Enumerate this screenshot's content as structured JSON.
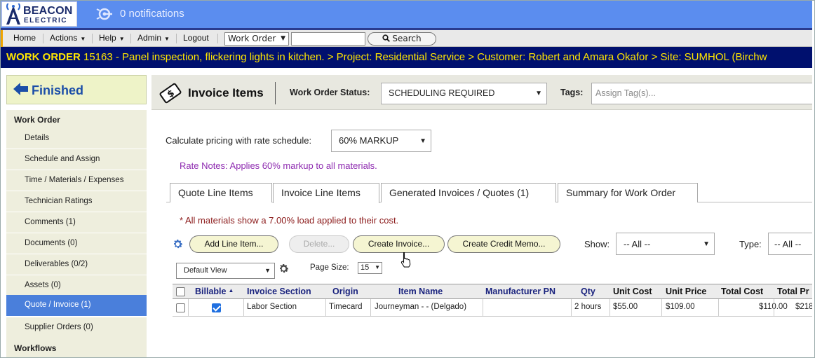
{
  "brand": {
    "line1": "BEACON",
    "line2": "ELECTRIC"
  },
  "notifications": {
    "text": "0 notifications"
  },
  "menu": {
    "home": "Home",
    "actions": "Actions",
    "help": "Help",
    "admin": "Admin",
    "logout": "Logout",
    "search_scope": "Work Order",
    "search_value": "",
    "search_button": "Search"
  },
  "breadcrumb": {
    "prefix": "WORK ORDER",
    "text": " 15163 - Panel inspection, flickering lights in kitchen. > Project: Residential Service > Customer: Robert and Amara Okafor > Site: SUMHOL (Birchw"
  },
  "sidebar": {
    "finished": "Finished",
    "section_work_order": "Work Order",
    "items": [
      {
        "label": "Details"
      },
      {
        "label": "Schedule and Assign"
      },
      {
        "label": "Time / Materials / Expenses"
      },
      {
        "label": "Technician Ratings"
      },
      {
        "label": "Comments (1)"
      },
      {
        "label": "Documents (0)"
      },
      {
        "label": "Deliverables (0/2)"
      },
      {
        "label": "Assets (0)"
      },
      {
        "label": "Quote / Invoice (1)"
      },
      {
        "label": "Supplier Orders (0)"
      }
    ],
    "section_workflows": "Workflows"
  },
  "header": {
    "title": "Invoice Items",
    "status_label": "Work Order Status:",
    "status_value": "SCHEDULING REQUIRED",
    "tags_label": "Tags:",
    "tags_placeholder": "Assign Tag(s)..."
  },
  "pricing": {
    "label": "Calculate pricing with rate schedule:",
    "value": "60% MARKUP",
    "notes": "Rate Notes: Applies 60% markup to all materials."
  },
  "tabs": [
    {
      "label": "Quote Line Items"
    },
    {
      "label": "Invoice Line Items"
    },
    {
      "label": "Generated Invoices / Quotes (1)"
    },
    {
      "label": "Summary for Work Order"
    }
  ],
  "materials_note": "* All materials show a 7.00% load applied to their cost.",
  "actions": {
    "add": "Add Line Item...",
    "delete": "Delete...",
    "create_invoice": "Create Invoice...",
    "credit_memo": "Create Credit Memo...",
    "show_label": "Show:",
    "show_value": "-- All --",
    "type_label": "Type:",
    "type_value": "-- All --"
  },
  "view": {
    "value": "Default View",
    "page_size_label": "Page Size:",
    "page_size_value": "15"
  },
  "grid": {
    "headers": {
      "billable": "Billable",
      "sort_indicator": "▲",
      "invoice_section": "Invoice Section",
      "origin": "Origin",
      "item_name": "Item Name",
      "manufacturer_pn": "Manufacturer PN",
      "qty": "Qty",
      "unit_cost": "Unit Cost",
      "unit_price": "Unit Price",
      "total_cost": "Total Cost",
      "total_price": "Total Pr"
    },
    "rows": [
      {
        "billable": true,
        "invoice_section": "Labor Section",
        "origin": "Timecard",
        "item_name": "Journeyman - - (Delgado)",
        "manufacturer_pn": "",
        "qty": "2 hours",
        "unit_cost": "$55.00",
        "unit_price": "$109.00",
        "total_cost": "$110.00",
        "total_price": "$218"
      }
    ]
  },
  "colors": {
    "banner": "#5b8def",
    "crumb_bg": "#00106e",
    "crumb_text": "#ffe600",
    "active_nav": "#4a7fdb",
    "rate_notes": "#8e2bb0",
    "materials_note": "#8b1a1a"
  }
}
